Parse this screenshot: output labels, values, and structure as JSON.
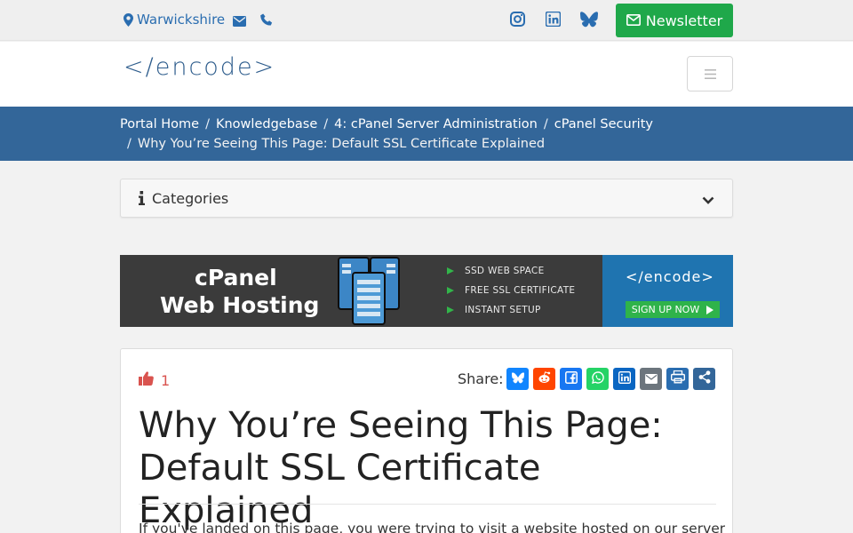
{
  "topbar": {
    "location": "Warwickshire",
    "newsletter_label": "Newsletter",
    "icons": [
      "map-marker-icon",
      "envelope-icon",
      "phone-icon",
      "instagram-icon",
      "linkedin-icon",
      "bluesky-icon"
    ]
  },
  "header": {
    "logo_text": "</encode>",
    "menu_icon": "hamburger-icon"
  },
  "breadcrumb": {
    "separator": "/",
    "items": [
      {
        "label": "Portal Home"
      },
      {
        "label": "Knowledgebase"
      },
      {
        "label": "4: cPanel Server Administration"
      },
      {
        "label": "cPanel Security"
      },
      {
        "label": "Why You’re Seeing This Page: Default SSL Certificate Explained"
      }
    ]
  },
  "categories": {
    "label": "Categories"
  },
  "banner": {
    "title_line1": "cPanel",
    "title_line2": "Web Hosting",
    "features": [
      "SSD WEB SPACE",
      "FREE SSL CERTIFICATE",
      "INSTANT SETUP"
    ],
    "logo_text": "</encode>",
    "cta": "SIGN UP NOW"
  },
  "article": {
    "likes": "1",
    "share_label": "Share:",
    "share_buttons": [
      {
        "name": "bluesky",
        "color": "#1185fe"
      },
      {
        "name": "reddit",
        "color": "#ff4500"
      },
      {
        "name": "facebook",
        "color": "#1877f2"
      },
      {
        "name": "whatsapp",
        "color": "#25d366"
      },
      {
        "name": "linkedin",
        "color": "#0a66c2"
      },
      {
        "name": "email",
        "color": "#6c757d"
      },
      {
        "name": "print",
        "color": "#2a6db0"
      },
      {
        "name": "share",
        "color": "#336699"
      }
    ],
    "title": "Why You’re Seeing This Page: Default SSL Certificate Explained",
    "intro": "If you've landed on this page, you were trying to visit a website hosted on our servers"
  },
  "colors": {
    "accent_blue": "#336699",
    "newsletter_green": "#1fa84a",
    "like_red": "#d9534f"
  }
}
